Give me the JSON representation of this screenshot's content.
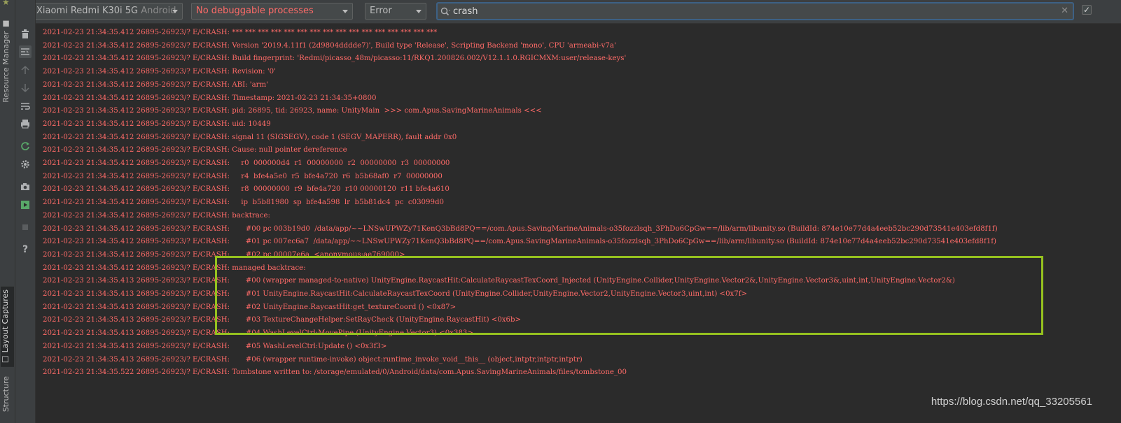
{
  "side_tabs": {
    "resource_manager": "Resource Manager",
    "layout_captures": "Layout Captures",
    "structure": "Structure"
  },
  "toolbar": {
    "device_name": "Xiaomi Redmi K30i 5G",
    "device_os": "Android",
    "process": "No debuggable processes",
    "log_level": "Error",
    "search_value": "crash",
    "regex_checked": true
  },
  "left_tools": [
    "trash-icon",
    "scroll-to-end-icon",
    "up-arrow-icon",
    "down-arrow-icon",
    "soft-wrap-icon",
    "print-icon",
    "restart-icon",
    "settings-icon",
    "screenshot-icon",
    "screen-record-icon",
    "stop-icon",
    "help-icon"
  ],
  "log_lines": [
    "2021-02-23 21:34:35.412 26895-26923/? E/CRASH: *** *** *** *** *** *** *** *** *** *** *** *** *** *** *** ***",
    "2021-02-23 21:34:35.412 26895-26923/? E/CRASH: Version '2019.4.11f1 (2d9804dddde7)', Build type 'Release', Scripting Backend 'mono', CPU 'armeabi-v7a'",
    "2021-02-23 21:34:35.412 26895-26923/? E/CRASH: Build fingerprint: 'Redmi/picasso_48m/picasso:11/RKQ1.200826.002/V12.1.1.0.RGICMXM:user/release-keys'",
    "2021-02-23 21:34:35.412 26895-26923/? E/CRASH: Revision: '0'",
    "2021-02-23 21:34:35.412 26895-26923/? E/CRASH: ABI: 'arm'",
    "2021-02-23 21:34:35.412 26895-26923/? E/CRASH: Timestamp: 2021-02-23 21:34:35+0800",
    "2021-02-23 21:34:35.412 26895-26923/? E/CRASH: pid: 26895, tid: 26923, name: UnityMain  >>> com.Apus.SavingMarineAnimals <<<",
    "2021-02-23 21:34:35.412 26895-26923/? E/CRASH: uid: 10449",
    "2021-02-23 21:34:35.412 26895-26923/? E/CRASH: signal 11 (SIGSEGV), code 1 (SEGV_MAPERR), fault addr 0x0",
    "2021-02-23 21:34:35.412 26895-26923/? E/CRASH: Cause: null pointer dereference",
    "2021-02-23 21:34:35.412 26895-26923/? E/CRASH:     r0  000000d4  r1  00000000  r2  00000000  r3  00000000",
    "2021-02-23 21:34:35.412 26895-26923/? E/CRASH:     r4  bfe4a5e0  r5  bfe4a720  r6  b5b68af0  r7  00000000",
    "2021-02-23 21:34:35.412 26895-26923/? E/CRASH:     r8  00000000  r9  bfe4a720  r10 00000120  r11 bfe4a610",
    "2021-02-23 21:34:35.412 26895-26923/? E/CRASH:     ip  b5b81980  sp  bfe4a598  lr  b5b81dc4  pc  c03099d0",
    "2021-02-23 21:34:35.412 26895-26923/? E/CRASH: backtrace:",
    "2021-02-23 21:34:35.412 26895-26923/? E/CRASH:       #00 pc 003b19d0  /data/app/~~LNSwUPWZy71KenQ3bBd8PQ==/com.Apus.SavingMarineAnimals-o35fozzlsqh_3PhDo6CpGw==/lib/arm/libunity.so (BuildId: 874e10e77d4a4eeb52bc290d73541e403efd8f1f)",
    "2021-02-23 21:34:35.412 26895-26923/? E/CRASH:       #01 pc 007ec6a7  /data/app/~~LNSwUPWZy71KenQ3bBd8PQ==/com.Apus.SavingMarineAnimals-o35fozzlsqh_3PhDo6CpGw==/lib/arm/libunity.so (BuildId: 874e10e77d4a4eeb52bc290d73541e403efd8f1f)",
    "2021-02-23 21:34:35.412 26895-26923/? E/CRASH:       #02 pc 00007e6a  <anonymous:ae769000>",
    "2021-02-23 21:34:35.412 26895-26923/? E/CRASH: managed backtrace:",
    "2021-02-23 21:34:35.413 26895-26923/? E/CRASH:       #00 (wrapper managed-to-native) UnityEngine.RaycastHit:CalculateRaycastTexCoord_Injected (UnityEngine.Collider,UnityEngine.Vector2&,UnityEngine.Vector3&,uint,int,UnityEngine.Vector2&)",
    "2021-02-23 21:34:35.413 26895-26923/? E/CRASH:       #01 UnityEngine.RaycastHit:CalculateRaycastTexCoord (UnityEngine.Collider,UnityEngine.Vector2,UnityEngine.Vector3,uint,int) <0x7f>",
    "2021-02-23 21:34:35.413 26895-26923/? E/CRASH:       #02 UnityEngine.RaycastHit:get_textureCoord () <0x87>",
    "2021-02-23 21:34:35.413 26895-26923/? E/CRASH:       #03 TextureChangeHelper:SetRayCheck (UnityEngine.RaycastHit) <0x6b>",
    "2021-02-23 21:34:35.413 26895-26923/? E/CRASH:       #04 WashLevelCtrl:MovePipe (UnityEngine.Vector3) <0x383>",
    "2021-02-23 21:34:35.413 26895-26923/? E/CRASH:       #05 WashLevelCtrl:Update () <0x3f3>",
    "2021-02-23 21:34:35.413 26895-26923/? E/CRASH:       #06 (wrapper runtime-invoke) object:runtime_invoke_void__this__ (object,intptr,intptr,intptr)",
    "2021-02-23 21:34:35.522 26895-26923/? E/CRASH: Tombstone written to: /storage/emulated/0/Android/data/com.Apus.SavingMarineAnimals/files/tombstone_00"
  ],
  "watermark": "https://blog.csdn.net/qq_33205561",
  "colors": {
    "error_text": "#ff6b68",
    "highlight_box": "#95c11f",
    "background": "#2b2b2b",
    "panel": "#3c3f41"
  }
}
